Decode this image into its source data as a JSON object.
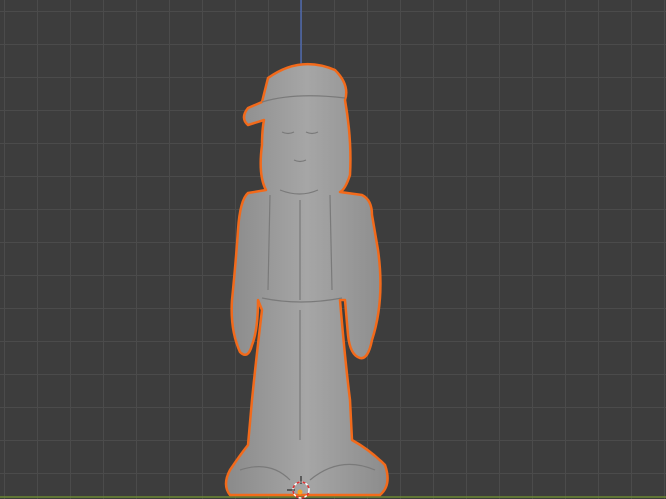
{
  "viewport": {
    "background_color": "#3d3d3d",
    "grid_color": "#4b4b4b",
    "selection_outline_color": "#f26a1b",
    "model_color": "#9a9a9a",
    "z_axis_color": "#4f72c9",
    "y_axis_color": "#7a9a3a"
  }
}
